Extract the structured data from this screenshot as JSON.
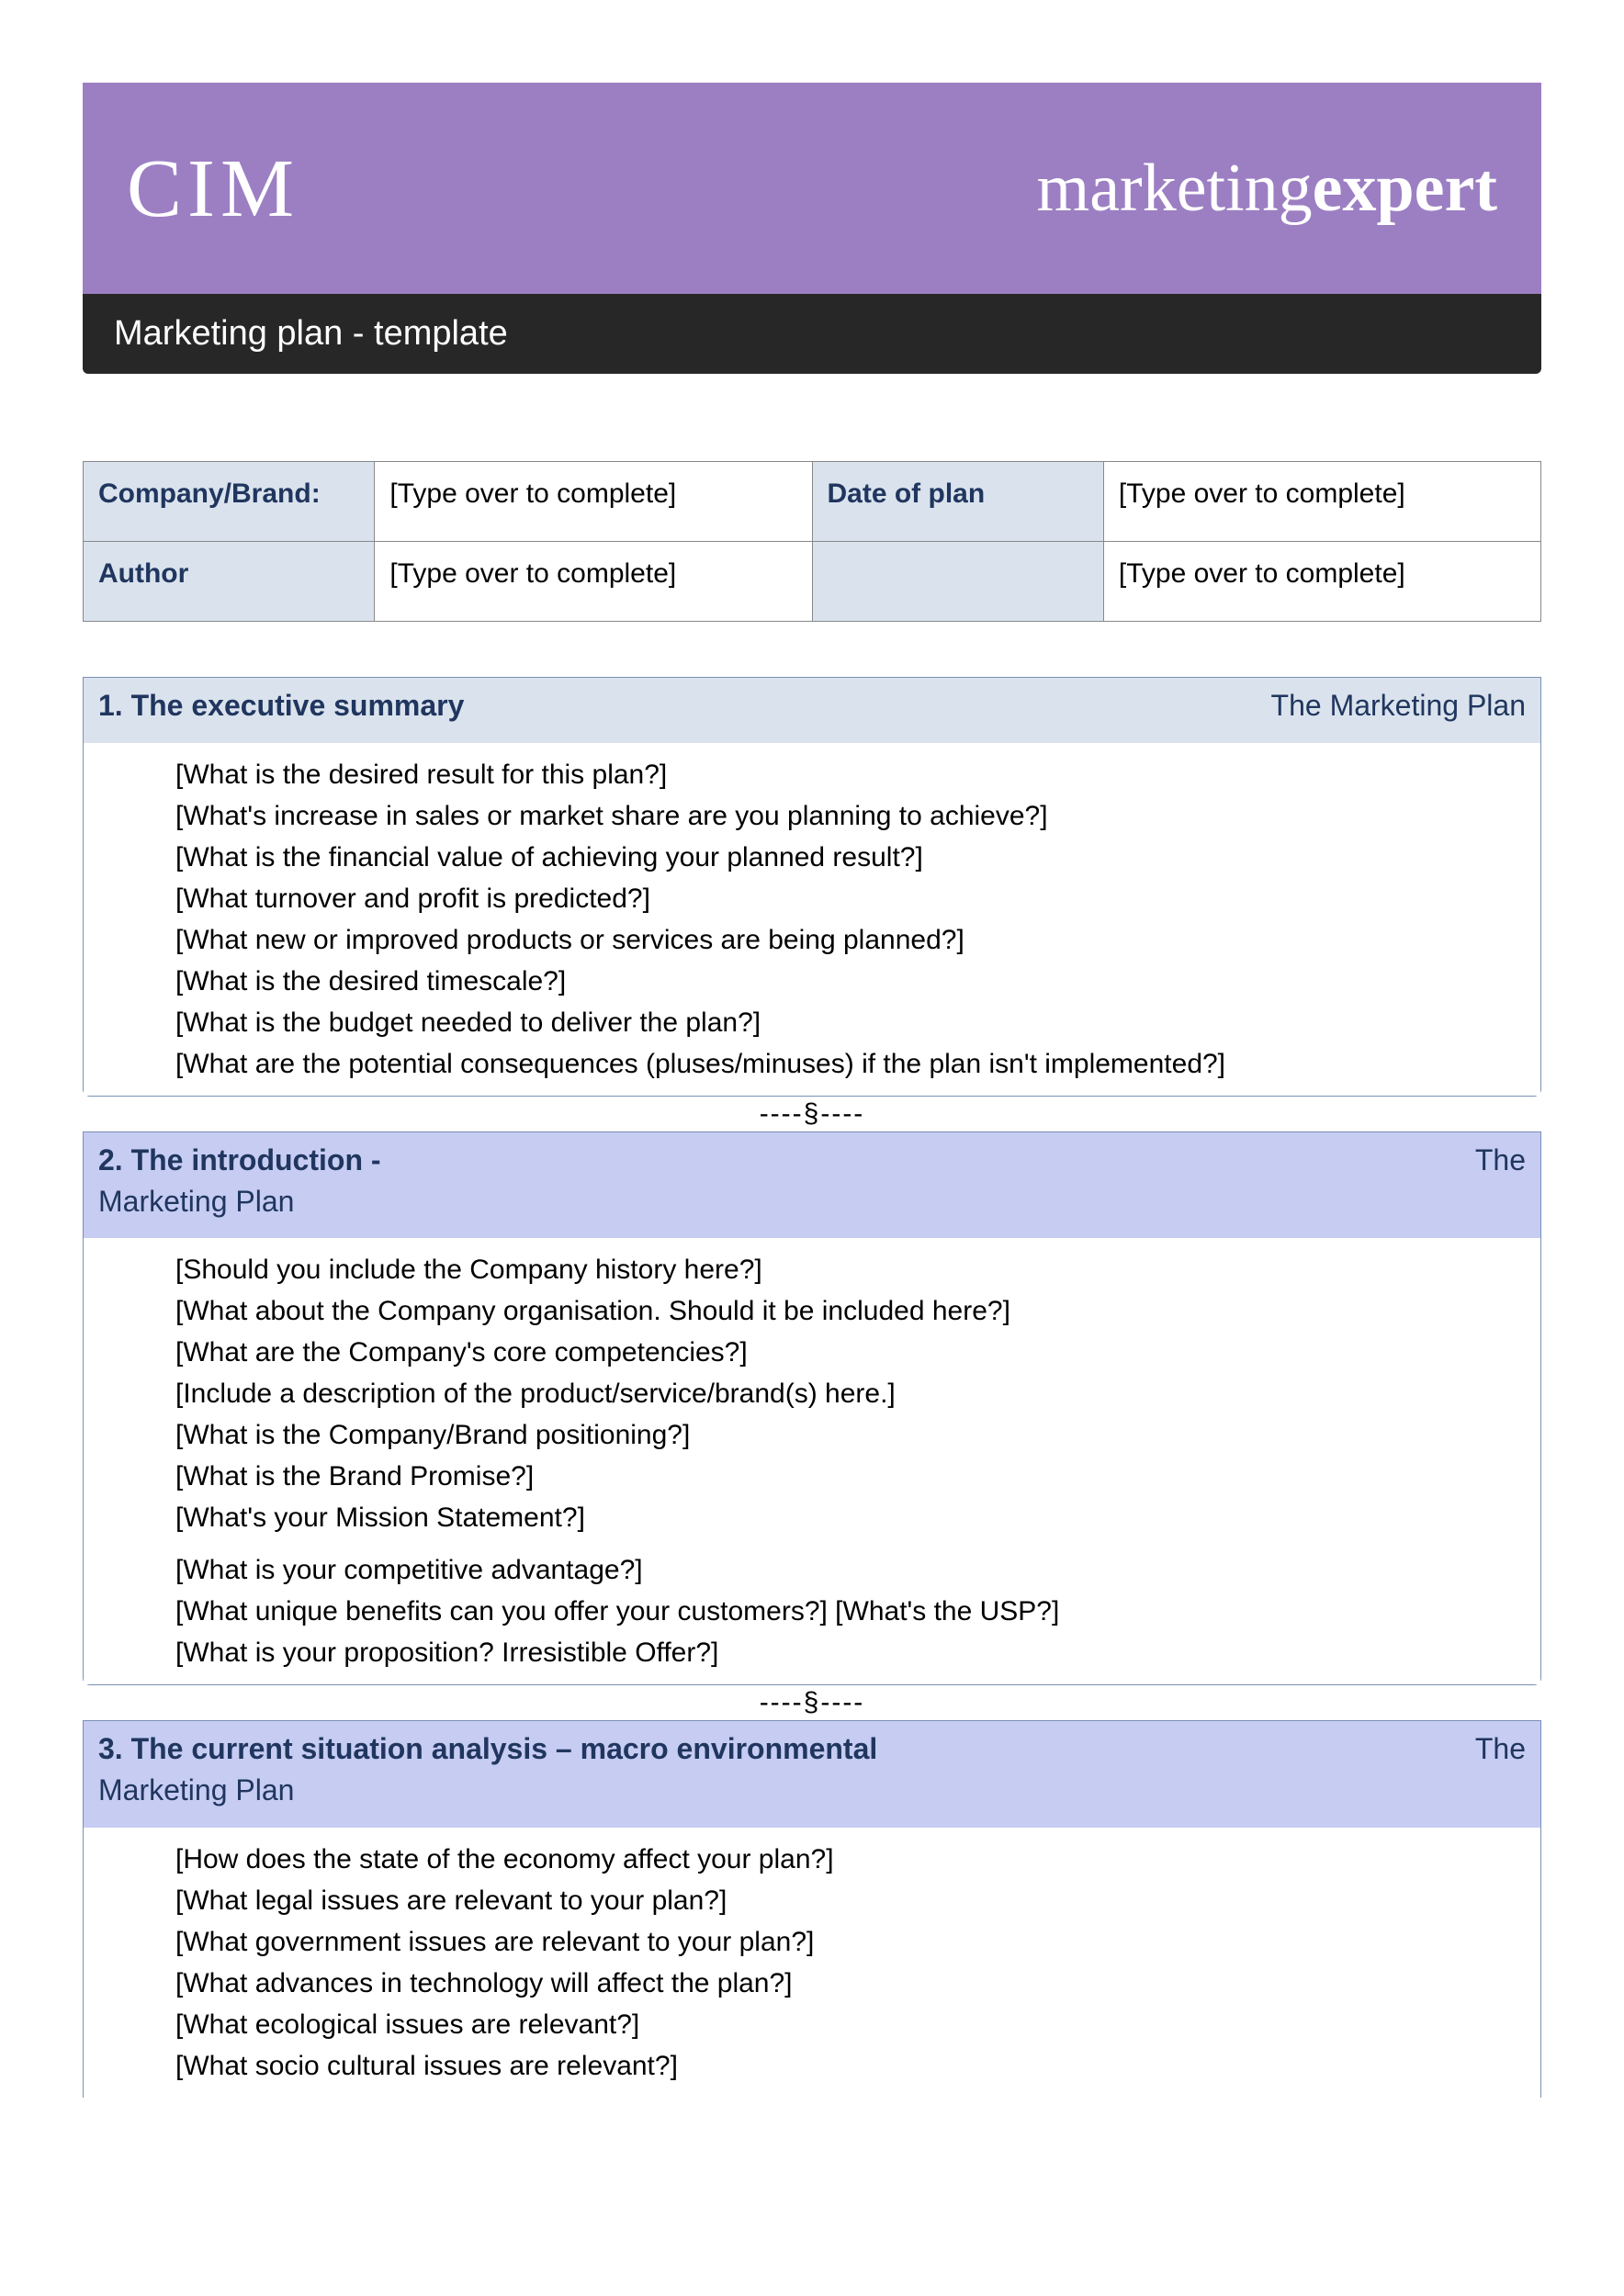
{
  "banner": {
    "logo": "CIM",
    "brand_prefix": "marketing",
    "brand_bold": "expert"
  },
  "titlebar": "Marketing plan - template",
  "info": {
    "company_label": "Company/Brand:",
    "company_value": "[Type over to complete]",
    "date_label": "Date of plan",
    "date_value": "[Type over to complete]",
    "author_label": "Author",
    "author_value": "[Type over to complete]",
    "extra_value": "[Type over to complete]"
  },
  "sections": [
    {
      "num_title": "1.  The executive summary",
      "right": "The Marketing Plan",
      "cont": "",
      "header_class": "hdr-blue",
      "items": [
        "[What is the desired result for this plan?]",
        "[What's increase in sales or market share are you planning to achieve?]",
        "[What is the financial value of achieving your planned result?]",
        "[What turnover and profit is predicted?]",
        "[What new or improved products or services are being planned?]",
        "[What is the desired timescale?]",
        "[What is the budget needed to deliver the plan?]",
        "[What are the potential consequences (pluses/minuses) if the plan isn't implemented?]"
      ]
    },
    {
      "num_title": "2.  The introduction -",
      "right": "The",
      "cont": "Marketing Plan",
      "header_class": "hdr-lilac",
      "items": [
        "[Should you include the Company history here?]",
        "[What about the Company organisation.  Should it be included here?]",
        "[What are the Company's core competencies?]",
        "[Include a description of the product/service/brand(s) here.]",
        "[What is the Company/Brand positioning?]",
        "[What is the Brand Promise?]",
        "[What's your Mission Statement?]"
      ],
      "items2": [
        "[What is your competitive advantage?]",
        "[What unique benefits can you offer your customers?]  [What's the USP?]",
        "[What is your proposition? Irresistible Offer?]"
      ]
    },
    {
      "num_title": "3. The current situation analysis – macro environmental",
      "right": "The",
      "cont": "Marketing Plan",
      "header_class": "hdr-lilac",
      "items": [
        "[How does the state of the economy affect your plan?]",
        "[What legal issues are relevant to your plan?]",
        "[What government issues are relevant to your plan?]",
        "[What advances in technology will affect the plan?]",
        "[What ecological issues are relevant?]",
        "[What socio cultural issues are relevant?]"
      ]
    }
  ],
  "separator": "----§----"
}
